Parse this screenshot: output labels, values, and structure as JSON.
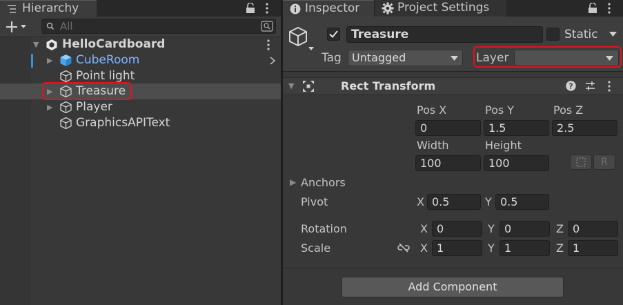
{
  "hierarchy": {
    "tab_label": "Hierarchy",
    "search_placeholder": "All",
    "scene_name": "HelloCardboard",
    "items": [
      {
        "label": "CubeRoom"
      },
      {
        "label": "Point light"
      },
      {
        "label": "Treasure"
      },
      {
        "label": "Player"
      },
      {
        "label": "GraphicsAPIText"
      }
    ]
  },
  "inspector": {
    "tab_label": "Inspector",
    "project_settings_label": "Project Settings",
    "object_name": "Treasure",
    "static_label": "Static",
    "tag_label": "Tag",
    "tag_value": "Untagged",
    "layer_label": "Layer",
    "layer_value": "",
    "component": {
      "title": "Rect Transform",
      "pos_x_label": "Pos X",
      "pos_y_label": "Pos Y",
      "pos_z_label": "Pos Z",
      "pos_x": "0",
      "pos_y": "1.5",
      "pos_z": "2.5",
      "width_label": "Width",
      "height_label": "Height",
      "width": "100",
      "height": "100",
      "raw_btn": "R",
      "anchors_label": "Anchors",
      "pivot_label": "Pivot",
      "pivot_x": "0.5",
      "pivot_y": "0.5",
      "rotation_label": "Rotation",
      "rot_x": "0",
      "rot_y": "0",
      "rot_z": "0",
      "scale_label": "Scale",
      "scale_x": "1",
      "scale_y": "1",
      "scale_z": "1",
      "x_label": "X",
      "y_label": "Y",
      "z_label": "Z"
    },
    "add_component_label": "Add Component"
  },
  "colors": {
    "highlight_red": "#e0141e",
    "prefab_blue": "#7fb6ff",
    "panel_bg": "#383838"
  }
}
